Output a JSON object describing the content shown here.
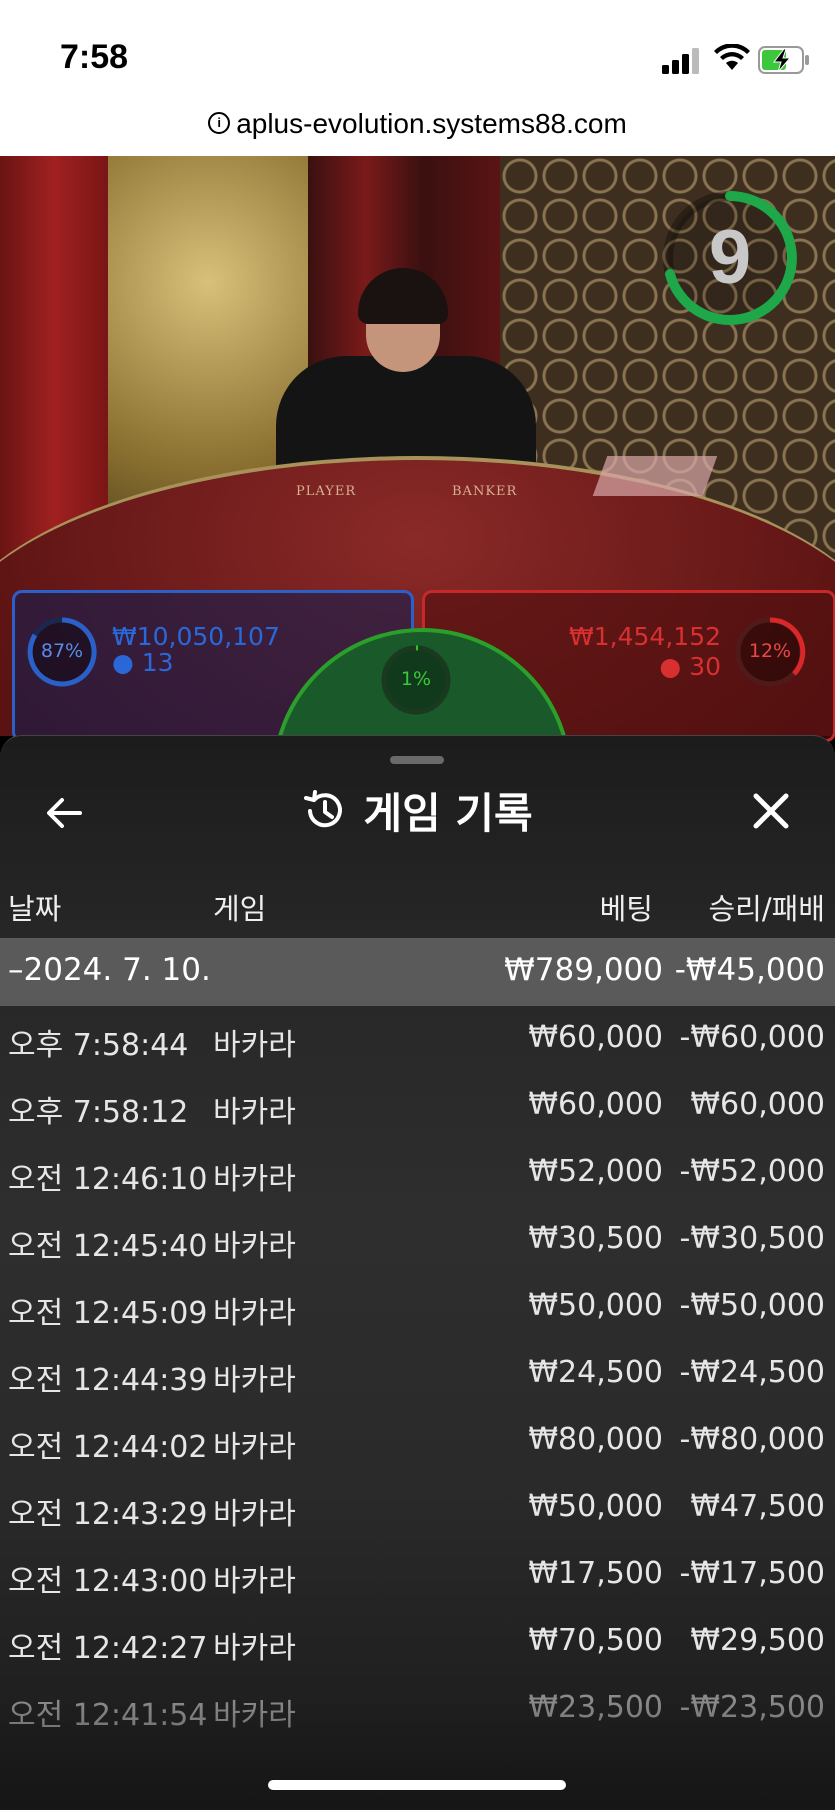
{
  "status_bar": {
    "time": "7:58"
  },
  "browser": {
    "url": "aplus-evolution.systems88.com"
  },
  "game": {
    "countdown": "9",
    "table_labels": {
      "player": "PLAYER",
      "banker": "BANKER"
    },
    "player": {
      "percent": "87%",
      "amount": "₩10,050,107",
      "count": "13"
    },
    "tie": {
      "percent": "1%"
    },
    "banker": {
      "percent": "12%",
      "amount": "₩1,454,152",
      "count": "30"
    }
  },
  "history": {
    "title": "게임 기록",
    "columns": {
      "date": "날짜",
      "game": "게임",
      "bet": "베팅",
      "result": "승리/패배"
    },
    "day": {
      "label": "–2024. 7. 10.",
      "bet": "₩789,000",
      "result": "-₩45,000"
    },
    "rows": [
      {
        "time": "오후 7:58:44",
        "game": "바카라",
        "bet": "₩60,000",
        "result": "-₩60,000"
      },
      {
        "time": "오후 7:58:12",
        "game": "바카라",
        "bet": "₩60,000",
        "result": "₩60,000"
      },
      {
        "time": "오전 12:46:10",
        "game": "바카라",
        "bet": "₩52,000",
        "result": "-₩52,000"
      },
      {
        "time": "오전 12:45:40",
        "game": "바카라",
        "bet": "₩30,500",
        "result": "-₩30,500"
      },
      {
        "time": "오전 12:45:09",
        "game": "바카라",
        "bet": "₩50,000",
        "result": "-₩50,000"
      },
      {
        "time": "오전 12:44:39",
        "game": "바카라",
        "bet": "₩24,500",
        "result": "-₩24,500"
      },
      {
        "time": "오전 12:44:02",
        "game": "바카라",
        "bet": "₩80,000",
        "result": "-₩80,000"
      },
      {
        "time": "오전 12:43:29",
        "game": "바카라",
        "bet": "₩50,000",
        "result": "₩47,500"
      },
      {
        "time": "오전 12:43:00",
        "game": "바카라",
        "bet": "₩17,500",
        "result": "-₩17,500"
      },
      {
        "time": "오전 12:42:27",
        "game": "바카라",
        "bet": "₩70,500",
        "result": "₩29,500"
      },
      {
        "time": "오전 12:41:54",
        "game": "바카라",
        "bet": "₩23,500",
        "result": "-₩23,500"
      }
    ]
  },
  "colors": {
    "player": "#2a60c8",
    "banker": "#c82828",
    "tie": "#2aa02a",
    "timer": "#1fa84a"
  },
  "icons": [
    "info-icon",
    "signal-icon",
    "wifi-icon",
    "battery-charging-icon",
    "back-arrow-icon",
    "history-icon",
    "close-icon",
    "person-icon"
  ]
}
